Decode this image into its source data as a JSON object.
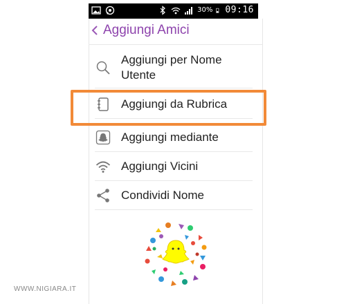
{
  "status_bar": {
    "battery": "30%",
    "time": "09:16",
    "icons": [
      "gallery-icon",
      "whatsapp-icon",
      "bluetooth-icon",
      "wifi-icon",
      "signal-icon",
      "battery-icon"
    ]
  },
  "header": {
    "back_icon": "chevron-left-icon",
    "title": "Aggiungi Amici"
  },
  "menu": {
    "items": [
      {
        "icon": "search-icon",
        "label": "Aggiungi per Nome Utente"
      },
      {
        "icon": "address-book-icon",
        "label": "Aggiungi da Rubrica"
      },
      {
        "icon": "ghost-icon",
        "label": "Aggiungi mediante"
      },
      {
        "icon": "wifi-icon",
        "label": "Aggiungi Vicini"
      },
      {
        "icon": "share-icon",
        "label": "Condividi Nome"
      }
    ],
    "highlighted_index": 1,
    "highlight_color": "#f28a38"
  },
  "accent_color": "#8e44ad",
  "watermark": "WWW.NIGIARA.IT"
}
